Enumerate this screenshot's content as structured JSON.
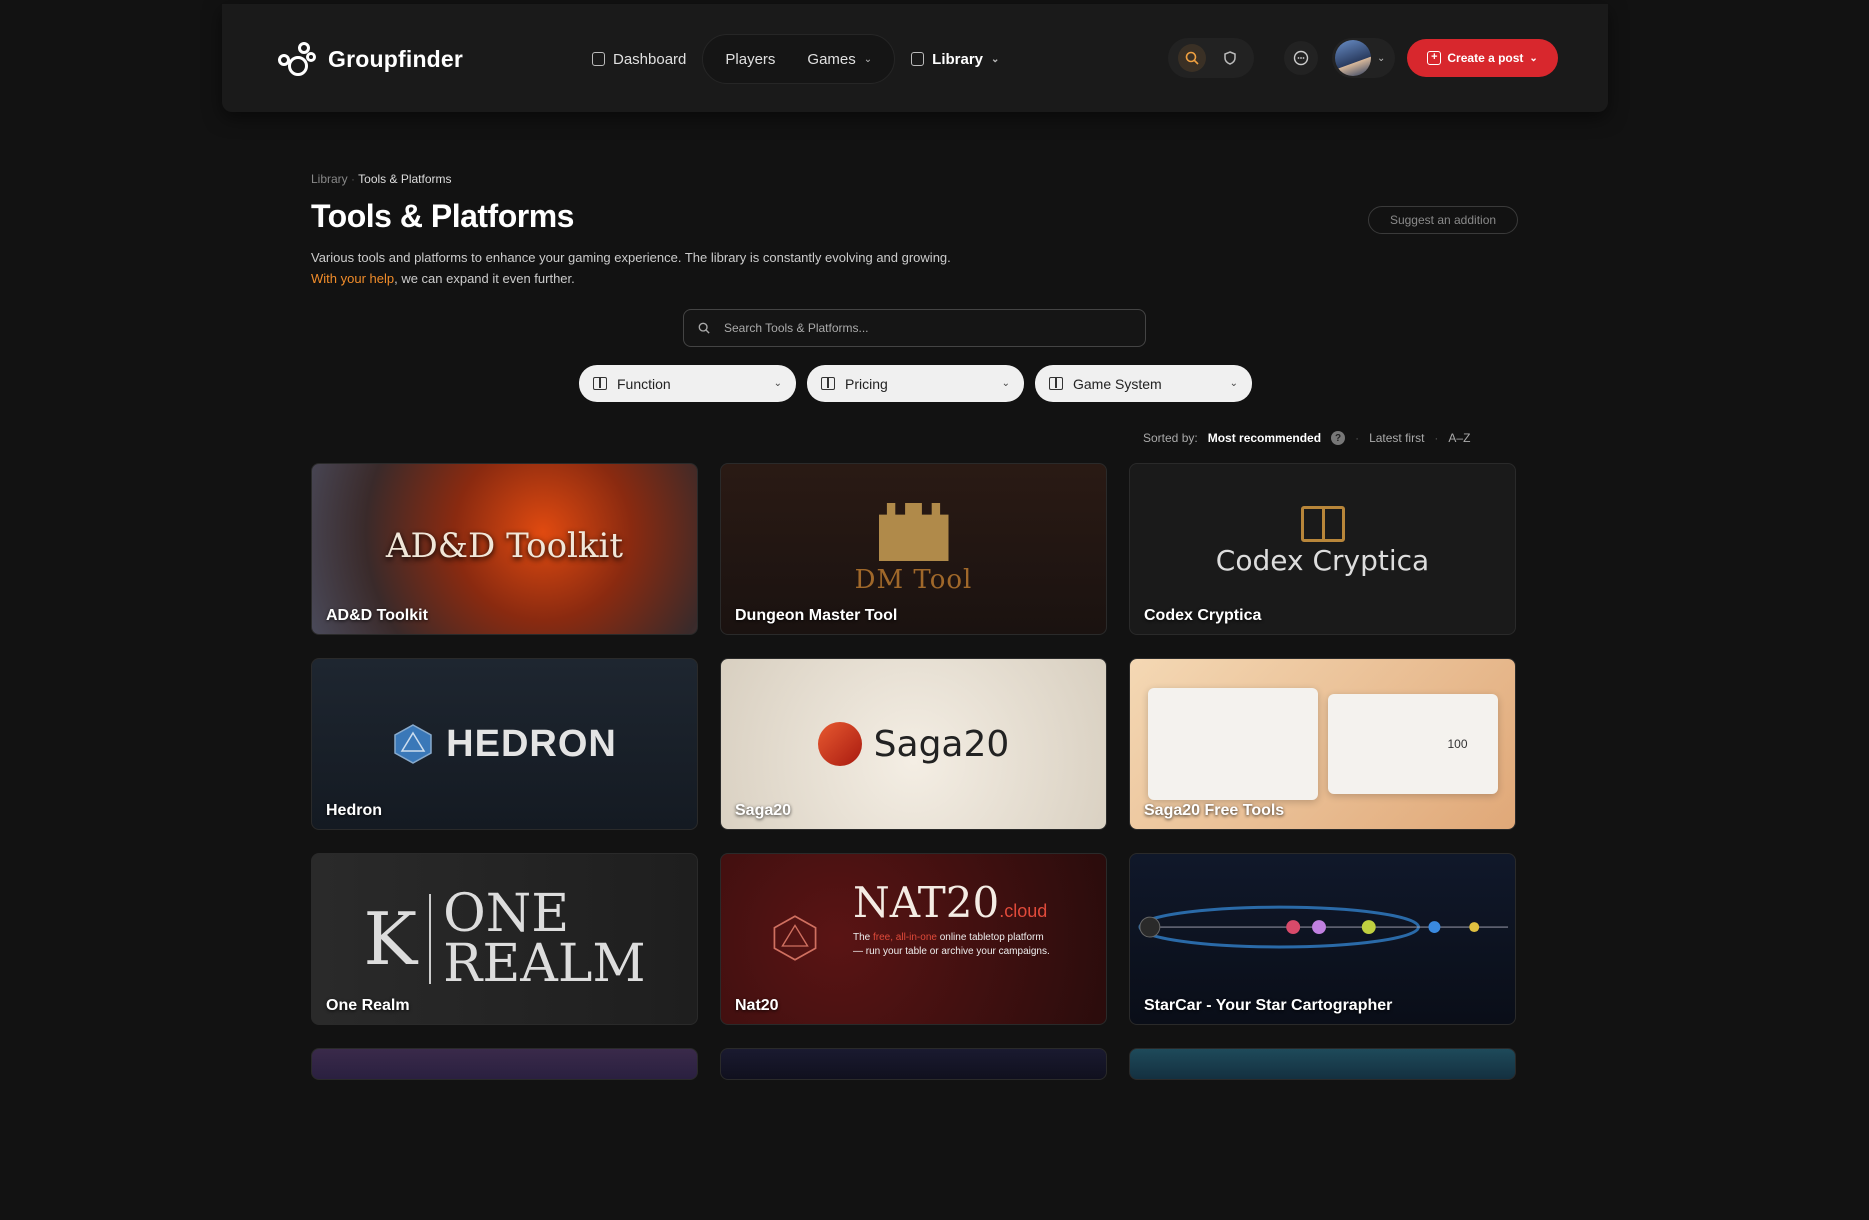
{
  "header": {
    "brand": "Groupfinder",
    "nav": {
      "dashboard": "Dashboard",
      "players": "Players",
      "games": "Games",
      "library": "Library"
    },
    "create_post": "Create a post"
  },
  "breadcrumb": {
    "root": "Library",
    "current": "Tools & Platforms"
  },
  "page": {
    "title": "Tools & Platforms",
    "intro_before": "Various tools and platforms to enhance your gaming experience. The library is constantly evolving and growing. ",
    "intro_link": "With your help",
    "intro_after": ", we can expand it even further.",
    "suggest": "Suggest an addition"
  },
  "search": {
    "placeholder": "Search Tools & Platforms..."
  },
  "filters": {
    "function": "Function",
    "pricing": "Pricing",
    "game_system": "Game System"
  },
  "sort": {
    "label": "Sorted by:",
    "options": [
      "Most recommended",
      "Latest first",
      "A–Z"
    ],
    "help": "?"
  },
  "cards": [
    {
      "name": "AD&D Toolkit",
      "art": "AD&D Toolkit"
    },
    {
      "name": "Dungeon Master Tool",
      "art": "DM Tool"
    },
    {
      "name": "Codex Cryptica",
      "art": "Codex Cryptica"
    },
    {
      "name": "Hedron",
      "art": "HEDRON"
    },
    {
      "name": "Saga20",
      "art": "Saga20"
    },
    {
      "name": "Saga20 Free Tools",
      "art": "100"
    },
    {
      "name": "One Realm",
      "art_line1": "ONE",
      "art_line2": "REALM"
    },
    {
      "name": "Nat20",
      "art": "NAT20",
      "art_suffix": ".cloud",
      "tagline_a": "The ",
      "tagline_free": "free, all-in-one",
      "tagline_b": " online tabletop platform",
      "tagline_c": "— run your table or archive your campaigns."
    },
    {
      "name": "StarCar - Your Star Cartographer"
    }
  ],
  "colors": {
    "accent": "#d8272d",
    "link": "#f08c2a",
    "background": "#121212"
  }
}
